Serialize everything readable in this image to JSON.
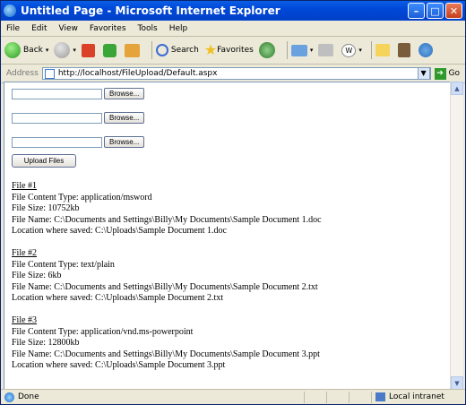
{
  "window": {
    "title": "Untitled Page - Microsoft Internet Explorer"
  },
  "menu": [
    "File",
    "Edit",
    "View",
    "Favorites",
    "Tools",
    "Help"
  ],
  "toolbar": {
    "back": "Back",
    "search": "Search",
    "favorites": "Favorites"
  },
  "address": {
    "label": "Address",
    "url": "http://localhost/FileUpload/Default.aspx",
    "go": "Go"
  },
  "form": {
    "browse_label": "Browse...",
    "upload_label": "Upload Files"
  },
  "files": [
    {
      "header": "File #1",
      "type": "File Content Type: application/msword",
      "size": "File Size: 10752kb",
      "name": "File Name: C:\\Documents and Settings\\Billy\\My Documents\\Sample Document 1.doc",
      "saved": "Location where saved: C:\\Uploads\\Sample Document 1.doc"
    },
    {
      "header": "File #2",
      "type": "File Content Type: text/plain",
      "size": "File Size: 6kb",
      "name": "File Name: C:\\Documents and Settings\\Billy\\My Documents\\Sample Document 2.txt",
      "saved": "Location where saved: C:\\Uploads\\Sample Document 2.txt"
    },
    {
      "header": "File #3",
      "type": "File Content Type: application/vnd.ms-powerpoint",
      "size": "File Size: 12800kb",
      "name": "File Name: C:\\Documents and Settings\\Billy\\My Documents\\Sample Document 3.ppt",
      "saved": "Location where saved: C:\\Uploads\\Sample Document 3.ppt"
    }
  ],
  "status": {
    "text": "Done",
    "zone": "Local intranet"
  }
}
